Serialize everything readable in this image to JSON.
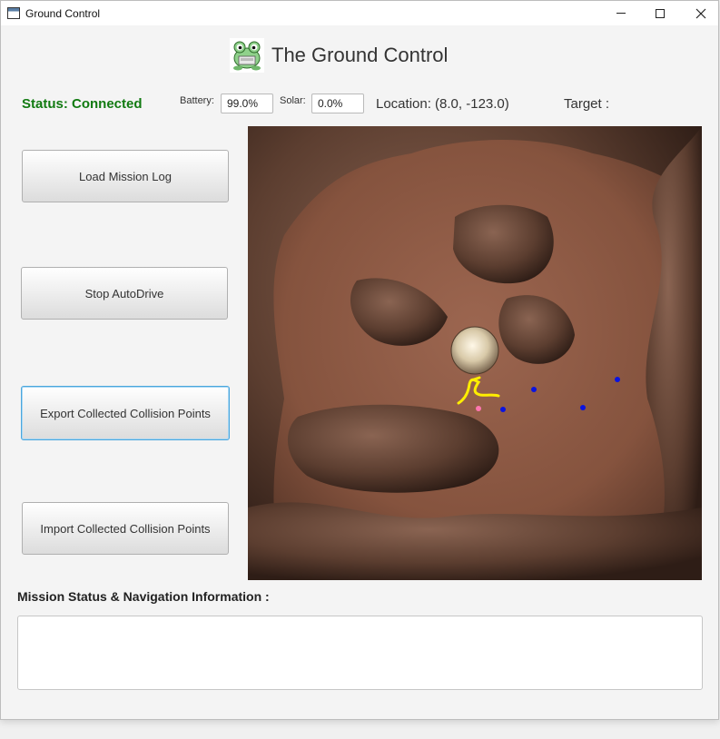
{
  "window": {
    "title": "Ground Control",
    "controls": {
      "minimize": "minimize-icon",
      "maximize": "maximize-icon",
      "close": "close-icon"
    }
  },
  "header": {
    "title": "The Ground Control",
    "logo_icon": "frog-icon"
  },
  "status": {
    "text": "Status: Connected",
    "color": "#117a11"
  },
  "telemetry": {
    "battery_label": "Battery:",
    "battery_value": "99.0%",
    "solar_label": "Solar:",
    "solar_value": "0.0%",
    "location": "Location: (8.0, -123.0)",
    "target": "Target :"
  },
  "sidebar": {
    "buttons": [
      {
        "label": "Load Mission Log"
      },
      {
        "label": "Stop AutoDrive"
      },
      {
        "label": "Export Collected Collision Points",
        "focused": true
      },
      {
        "label": "Import Collected Collision Points"
      }
    ]
  },
  "map": {
    "terrain": "rocky-canyon-top-down",
    "colors": {
      "ground": "#8a5a43",
      "rock": "#5a3a2c",
      "path": "#ffee00",
      "collision_point": "#0a14e0",
      "rover": "#ff77b0"
    }
  },
  "mission_info": {
    "label": "Mission Status & Navigation Information :",
    "value": ""
  }
}
